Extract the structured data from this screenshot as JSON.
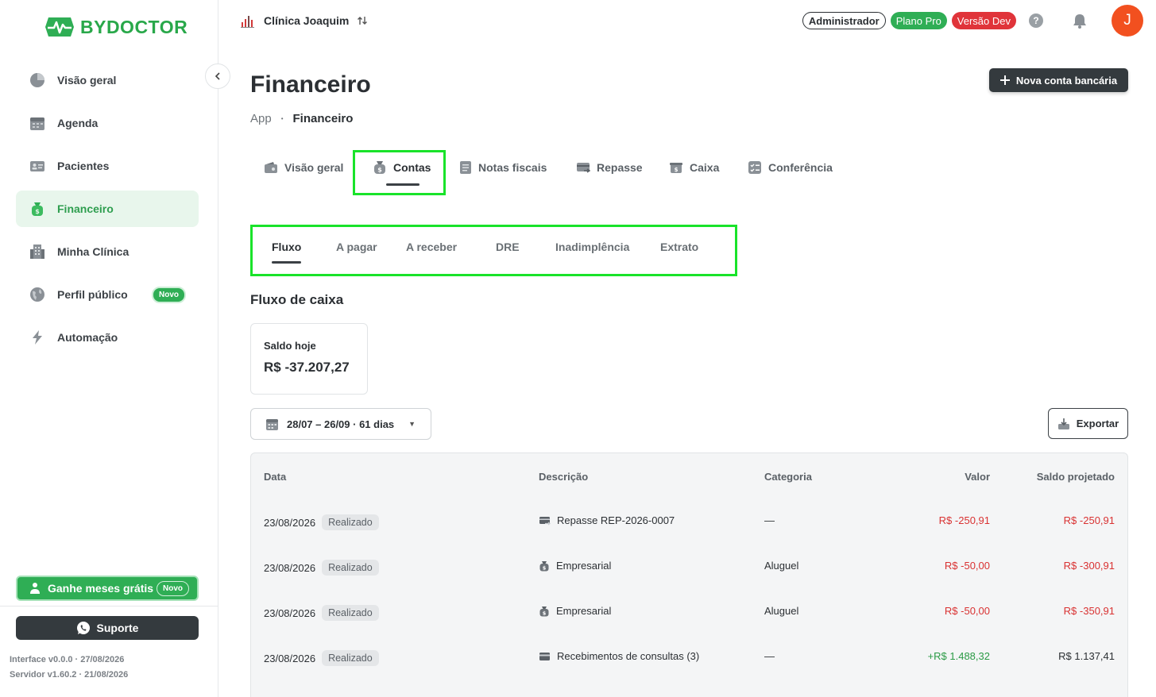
{
  "brand": {
    "name": "BYDOCTOR",
    "color": "#29a84a"
  },
  "sidebar": {
    "items": [
      {
        "label": "Visão geral",
        "icon": "pie-chart-icon"
      },
      {
        "label": "Agenda",
        "icon": "calendar-icon"
      },
      {
        "label": "Pacientes",
        "icon": "id-card-icon"
      },
      {
        "label": "Financeiro",
        "icon": "money-bag-icon",
        "active": true
      },
      {
        "label": "Minha Clínica",
        "icon": "building-icon"
      },
      {
        "label": "Perfil público",
        "icon": "globe-icon",
        "badge": "Novo"
      },
      {
        "label": "Automação",
        "icon": "lightning-icon"
      }
    ],
    "promo": {
      "label": "Ganhe meses grátis",
      "badge": "Novo"
    },
    "support_label": "Suporte",
    "interface_version": "Interface v0.0.0 · 27/08/2026",
    "server_version": "Servidor v1.60.2 · 21/08/2026"
  },
  "topbar": {
    "clinic_name": "Clínica Joaquim",
    "role": "Administrador",
    "plan": "Plano Pro",
    "version": "Versão Dev",
    "help": "?",
    "avatar_initial": "J"
  },
  "header": {
    "title": "Financeiro",
    "breadcrumb": [
      "App",
      "Financeiro"
    ],
    "breadcrumb_sep": "•",
    "new_account_label": "Nova conta bancária"
  },
  "tabs": [
    {
      "label": "Visão geral"
    },
    {
      "label": "Contas",
      "active": true
    },
    {
      "label": "Notas fiscais"
    },
    {
      "label": "Repasse"
    },
    {
      "label": "Caixa"
    },
    {
      "label": "Conferência"
    }
  ],
  "subtabs": [
    {
      "label": "Fluxo",
      "active": true
    },
    {
      "label": "A pagar"
    },
    {
      "label": "A receber"
    },
    {
      "label": "DRE"
    },
    {
      "label": "Inadimplência"
    },
    {
      "label": "Extrato"
    }
  ],
  "flow": {
    "title": "Fluxo de caixa",
    "saldo_label": "Saldo hoje",
    "saldo_value": "R$ -37.207,27",
    "date_range": "28/07 – 26/09 · 61 dias",
    "export_label": "Exportar"
  },
  "table": {
    "headers": [
      "Data",
      "Descrição",
      "Categoria",
      "Valor",
      "Saldo projetado"
    ],
    "rows": [
      {
        "date": "23/08/2026",
        "status": "Realizado",
        "description": "Repasse REP-2026-0007",
        "category": "—",
        "value": "R$ -250,91",
        "balance": "R$ -250,91"
      },
      {
        "date": "23/08/2026",
        "status": "Realizado",
        "description": "Empresarial",
        "category": "Aluguel",
        "value": "R$ -50,00",
        "balance": "R$ -300,91"
      },
      {
        "date": "23/08/2026",
        "status": "Realizado",
        "description": "Empresarial",
        "category": "Aluguel",
        "value": "R$ -50,00",
        "balance": "R$ -350,91"
      },
      {
        "date": "23/08/2026",
        "status": "Realizado",
        "description": "Recebimentos de consultas (3)",
        "category": "—",
        "value": "+R$ 1.488,32",
        "balance": "R$ 1.137,41"
      }
    ]
  }
}
